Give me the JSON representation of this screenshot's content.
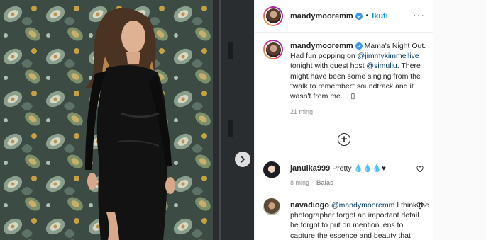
{
  "post": {
    "username": "mandymooremm",
    "dot": "•",
    "follow_label": "Ikuti",
    "more_label": "···",
    "caption": {
      "text1": "Mama's Night Out. Had fun popping on ",
      "mention1": "@jimmykimmellive",
      "text2": " tonight with guest host ",
      "mention2": "@simuliu",
      "text3": ". There might have been some singing from the \"walk to remember\" soundtrack and it wasn't from me.... ",
      "emoji": "▯",
      "time": "21 ming"
    }
  },
  "comments": [
    {
      "username": "janulka999",
      "text": " Pretty 💧💧💧♥",
      "time": "8 ming",
      "reply_label": "Balas"
    },
    {
      "username": "navadiogo",
      "mention": "@mandymooremm",
      "text": " I think the photographer forgot an important detail he forgot to put on mention lens to capture the essence and beauty that exists inside you because the beauty"
    }
  ],
  "colors": {
    "accent": "#0095f6",
    "verified": "#3897f0",
    "mention": "#00376b",
    "muted": "#8e8e8e"
  },
  "icons": [
    "verified-badge-icon",
    "more-options-icon",
    "add-comment-icon",
    "heart-icon",
    "chevron-right-icon"
  ]
}
